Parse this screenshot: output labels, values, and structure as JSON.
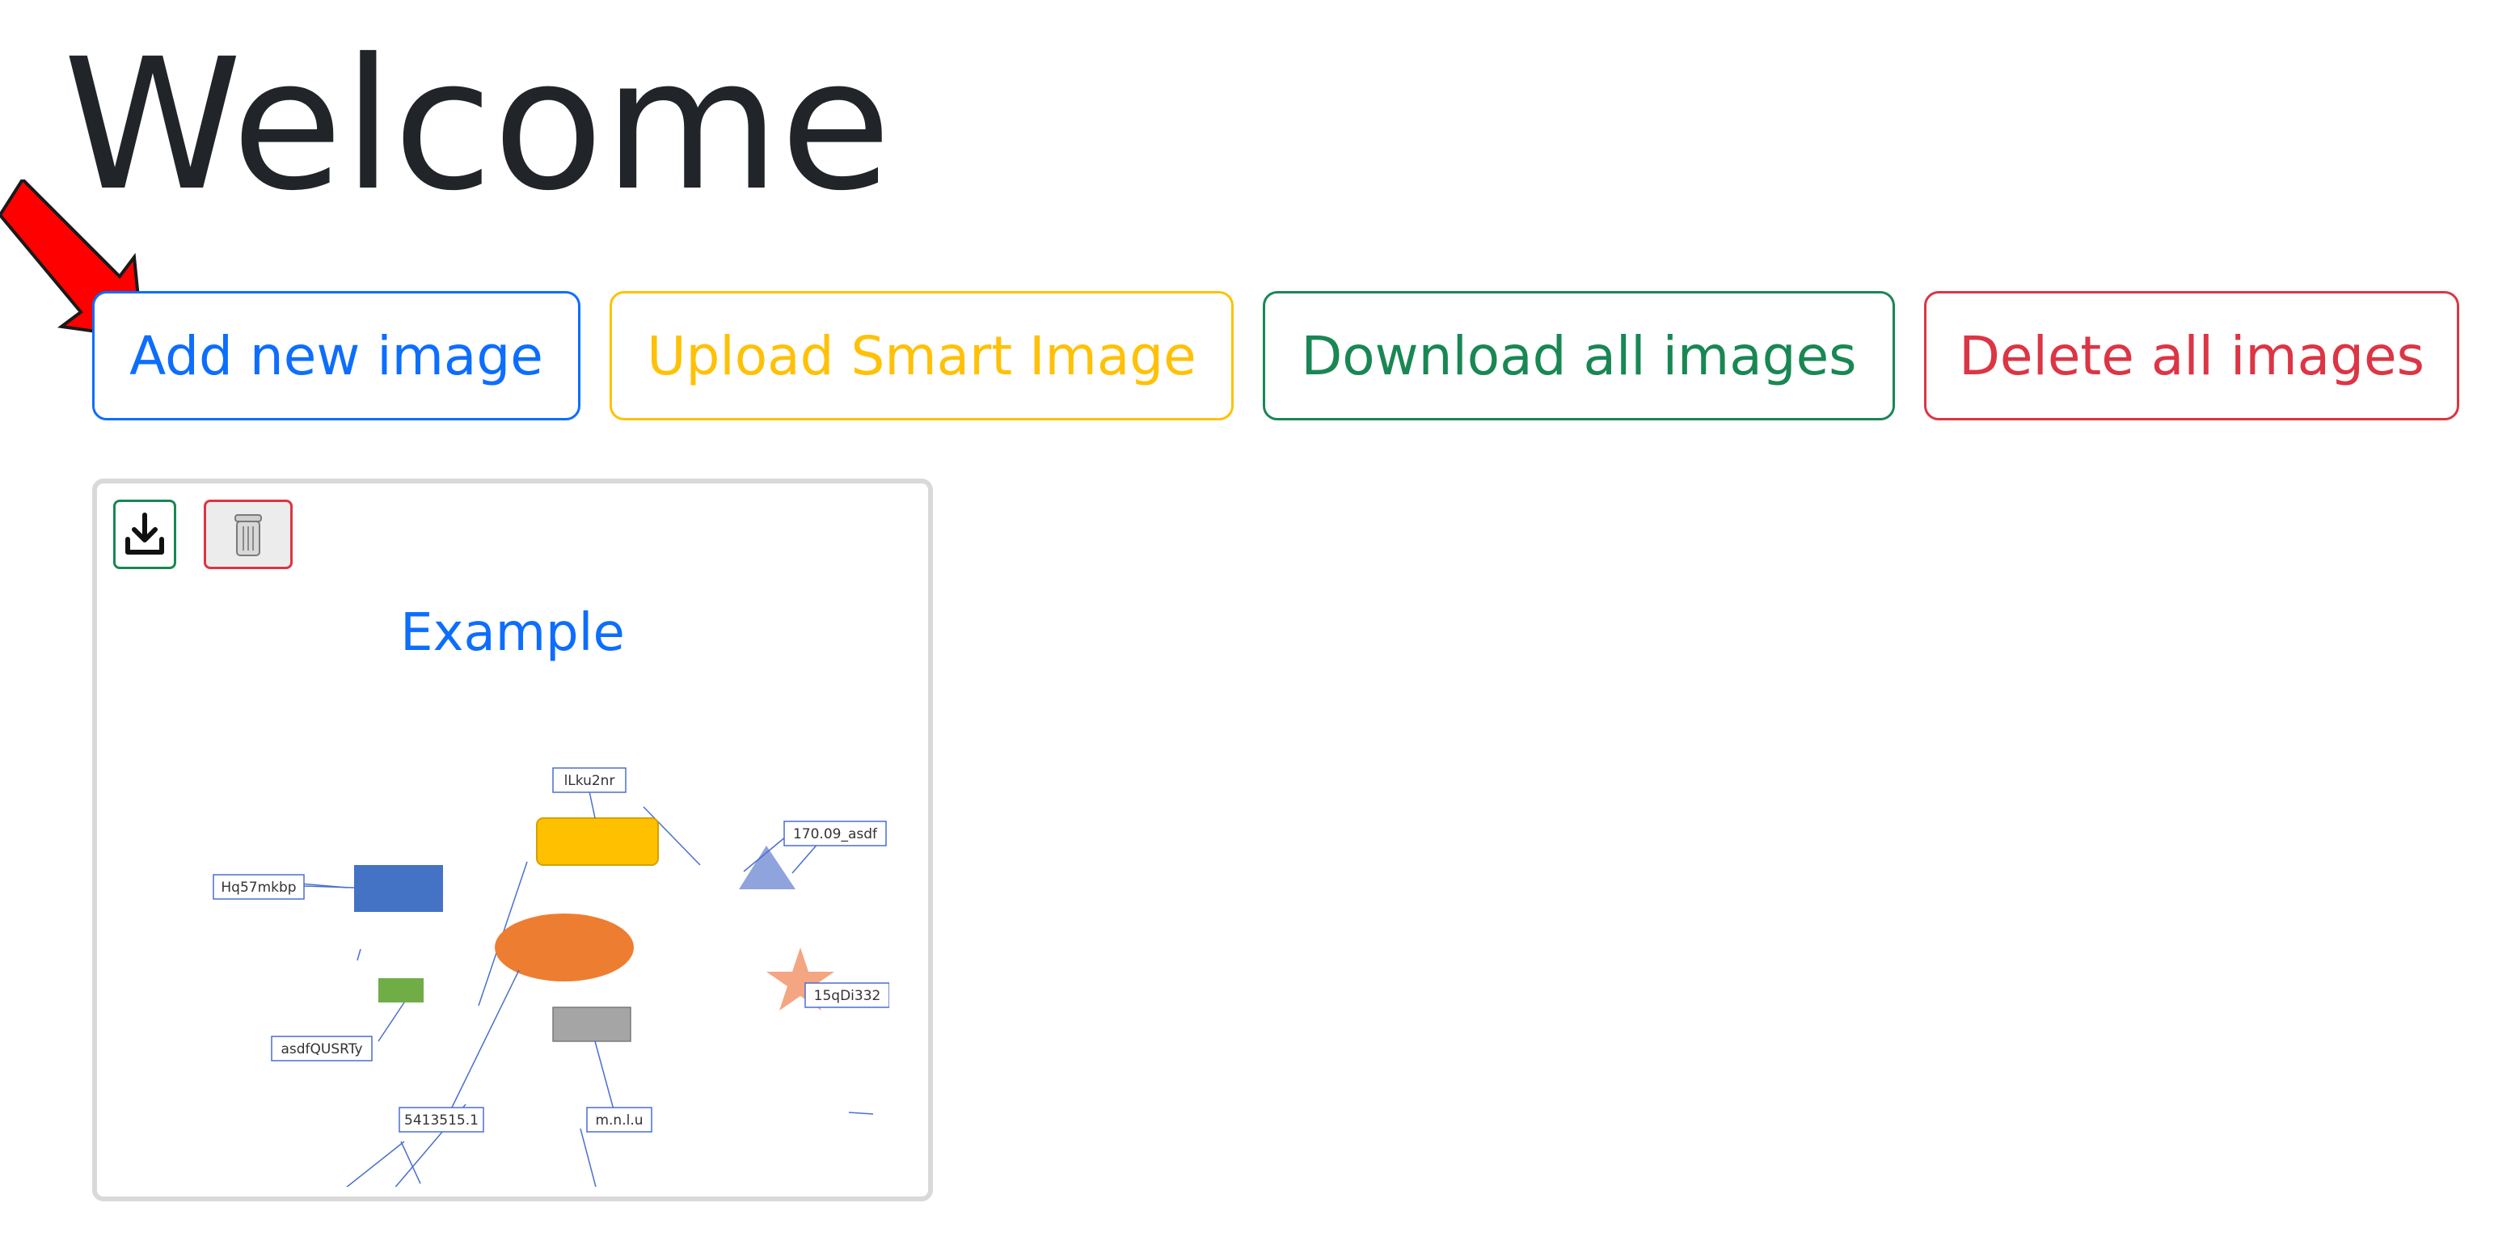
{
  "page": {
    "title": "Welcome"
  },
  "toolbar": {
    "add_label": "Add new image",
    "upload_label": "Upload Smart Image",
    "download_all_label": "Download all images",
    "delete_all_label": "Delete all images"
  },
  "colors": {
    "primary": "#0d6efd",
    "warning": "#ffc107",
    "success": "#198754",
    "danger": "#dc3545",
    "arrow": "#ff0000"
  },
  "card": {
    "title": "Example",
    "download_icon": "download-icon",
    "delete_icon": "trash-icon",
    "diagram_labels": {
      "rounded_rect": "lLku2nr",
      "triangle": "170.09_asdf",
      "blue_rect": "Hq57mkbp",
      "star": "15qDi332",
      "green_rect": "asdfQUSRTy",
      "ellipse": "5413515.1",
      "gray_rect": "m.n.l.u"
    }
  }
}
